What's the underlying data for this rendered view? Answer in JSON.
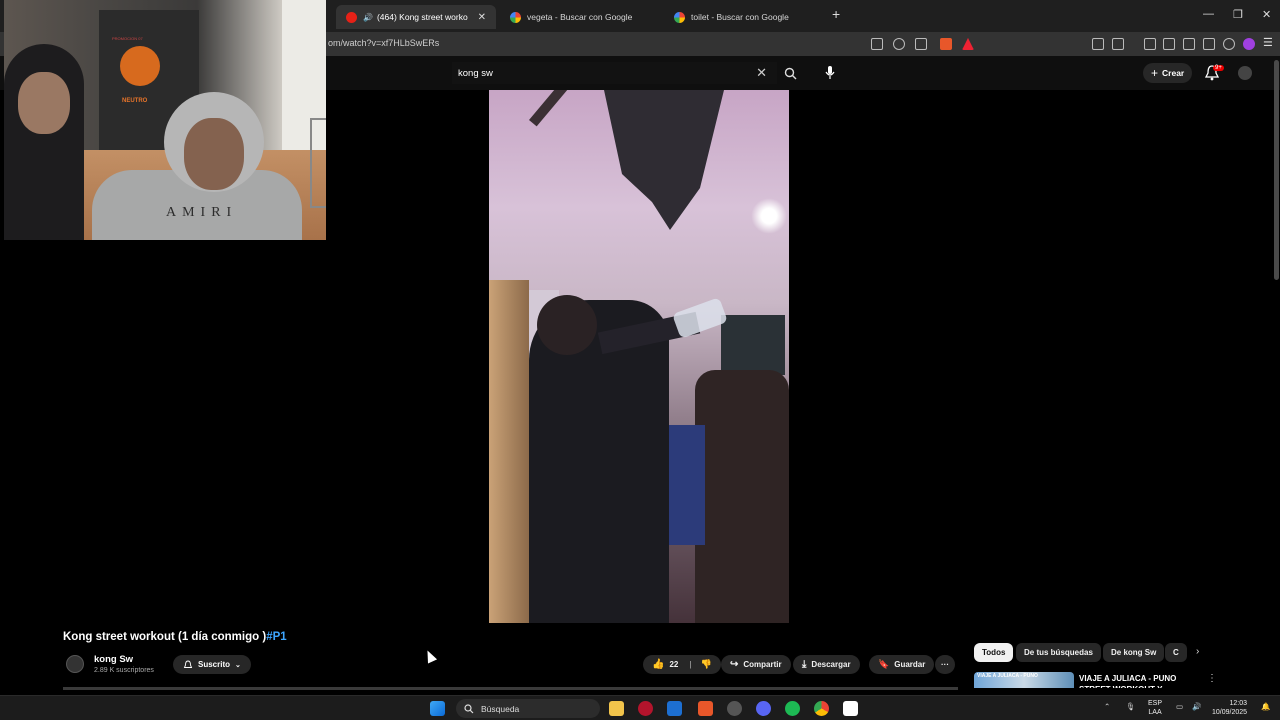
{
  "browser": {
    "tabs": [
      {
        "label": "(464) Kong street workout (1",
        "active": true,
        "favicon": "youtube-icon"
      },
      {
        "label": "vegeta - Buscar con Google",
        "active": false,
        "favicon": "google-icon"
      },
      {
        "label": "toilet - Buscar con Google",
        "active": false,
        "favicon": "google-icon"
      }
    ],
    "new_tab": "+",
    "url": "om/watch?v=xf7HLbSwERs",
    "close_glyph": "✕"
  },
  "youtube": {
    "search_value": "kong sw",
    "create_label": "Crear",
    "notifications_badge": "9+"
  },
  "webcam": {
    "poster_top_text": "PROMOCION 07",
    "poster_logo_text": "NEUTRO",
    "shirt_text": "AMIRI"
  },
  "video": {
    "title": "Kong street workout (1 día conmigo )",
    "hashtag": "#P1",
    "channel_name": "kong Sw",
    "subscribers": "2.89 K suscriptores",
    "subscribed_label": "Suscrito",
    "likes": "22",
    "share_label": "Compartir",
    "download_label": "Descargar",
    "save_label": "Guardar",
    "more_label": "···"
  },
  "sidebar": {
    "chips": [
      {
        "label": "Todos",
        "active": true
      },
      {
        "label": "De tus búsquedas",
        "active": false
      },
      {
        "label": "De kong Sw",
        "active": false
      },
      {
        "label": "C",
        "active": false
      }
    ],
    "related": [
      {
        "thumb_text": "VIAJE A JULIACA - PUNO",
        "title": "VIAJE A JULIACA - PUNO STREET WORKOUT Y"
      }
    ]
  },
  "taskbar": {
    "search_label": "Búsqueda",
    "lang_top": "ESP",
    "lang_bottom": "LAA",
    "time": "12:03",
    "date": "10/09/2025"
  },
  "colors": {
    "accent": "#3ea6ff",
    "background": "#0f0f0f",
    "badge": "#ee0000"
  }
}
